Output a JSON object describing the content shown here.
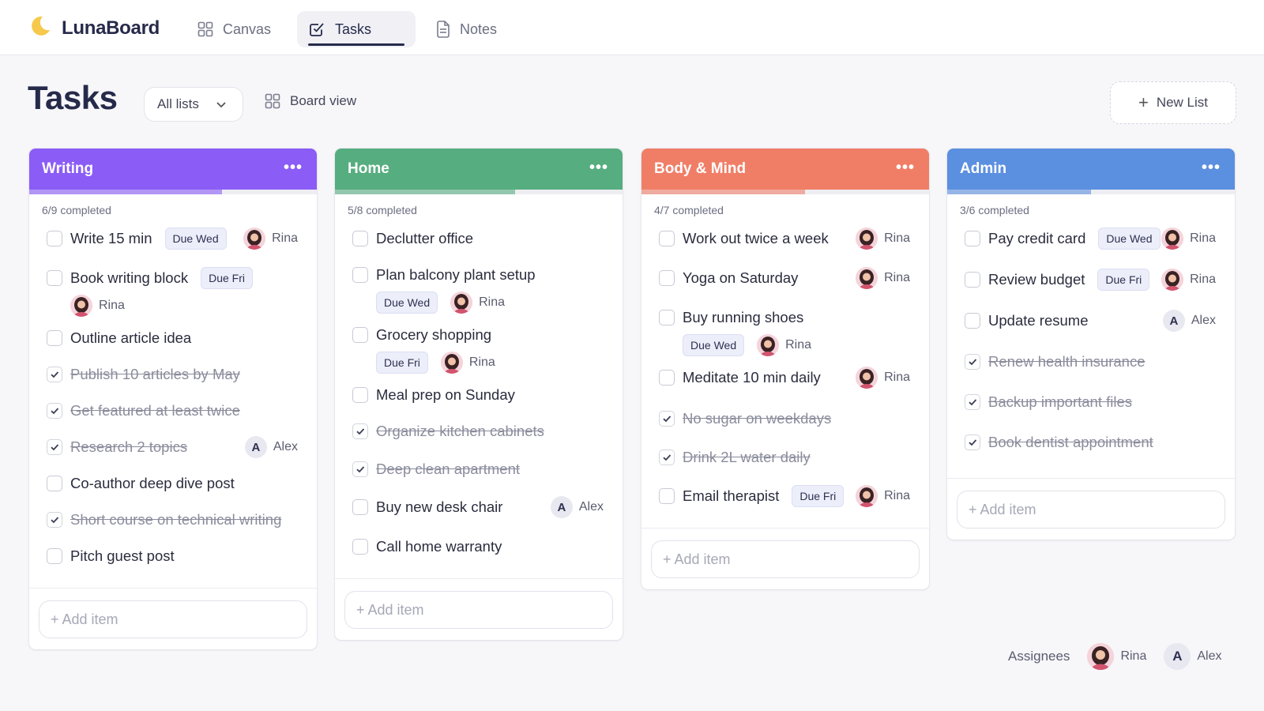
{
  "app": {
    "name": "LunaBoard"
  },
  "nav": {
    "tabs": [
      {
        "label": "Canvas",
        "icon": "grid-icon",
        "active": false
      },
      {
        "label": "Tasks",
        "icon": "checkbox-icon",
        "active": true
      },
      {
        "label": "Notes",
        "icon": "document-icon",
        "active": false
      }
    ]
  },
  "header": {
    "title": "Tasks",
    "filter": "All lists",
    "view": "Board view",
    "new_list": "New List"
  },
  "lists": [
    {
      "name": "Writing",
      "color": "#8b5cf6",
      "progress": 0.67,
      "completed": "6/9 completed",
      "items": [
        {
          "text": "Write 15 min",
          "due": "Due Wed",
          "assignee": "Rina",
          "done": false
        },
        {
          "text": "Book writing block",
          "due": "Due Fri",
          "assignee": "Rina",
          "done": false
        },
        {
          "text": "Outline article idea",
          "done": false
        },
        {
          "text": "Publish 10 articles by May",
          "done": true
        },
        {
          "text": "Get featured at least twice",
          "done": true
        },
        {
          "text": "Research 2 topics",
          "assignee": "Alex",
          "done": true
        },
        {
          "text": "Co-author deep dive post",
          "done": false
        },
        {
          "text": "Short course on technical writing",
          "done": true
        },
        {
          "text": "Pitch guest post",
          "done": false
        }
      ],
      "add_item": "+ Add item"
    },
    {
      "name": "Home",
      "color": "#56ad7f",
      "progress": 0.625,
      "completed": "5/8 completed",
      "items": [
        {
          "text": "Declutter office",
          "done": false
        },
        {
          "text": "Plan balcony plant setup",
          "due": "Due Wed",
          "assignee": "Rina",
          "done": false
        },
        {
          "text": "Grocery shopping",
          "due": "Due Fri",
          "assignee": "Rina",
          "done": false
        },
        {
          "text": "Meal prep on Sunday",
          "done": false
        },
        {
          "text": "Organize kitchen cabinets",
          "done": true
        },
        {
          "text": "Deep clean apartment",
          "done": true
        },
        {
          "text": "Buy new desk chair",
          "assignee": "Alex",
          "done": false
        },
        {
          "text": "Call home warranty",
          "done": false
        }
      ],
      "add_item": "+ Add item"
    },
    {
      "name": "Body & Mind",
      "color": "#f07e67",
      "progress": 0.57,
      "completed": "4/7 completed",
      "items": [
        {
          "text": "Work out twice a week",
          "assignee": "Rina",
          "done": false
        },
        {
          "text": "Yoga on Saturday",
          "assignee": "Rina",
          "done": false
        },
        {
          "text": "Buy running shoes",
          "due": "Due Wed",
          "assignee": "Rina",
          "done": false
        },
        {
          "text": "Meditate 10 min daily",
          "assignee": "Rina",
          "done": false
        },
        {
          "text": "No sugar on weekdays",
          "done": true
        },
        {
          "text": "Drink 2L water daily",
          "done": true
        },
        {
          "text": "Email therapist",
          "due": "Due Fri",
          "assignee": "Rina",
          "done": false
        }
      ],
      "add_item": "+ Add item"
    },
    {
      "name": "Admin",
      "color": "#5b8fe0",
      "progress": 0.5,
      "completed": "3/6 completed",
      "items": [
        {
          "text": "Pay credit card",
          "due": "Due Wed",
          "assignee": "Rina",
          "done": false
        },
        {
          "text": "Review budget",
          "due": "Due Fri",
          "assignee": "Rina",
          "done": false
        },
        {
          "text": "Update resume",
          "assignee": "Alex",
          "done": false
        },
        {
          "text": "Renew health insurance",
          "done": true
        },
        {
          "text": "Backup important files",
          "done": true
        },
        {
          "text": "Book dentist appointment",
          "done": true
        }
      ],
      "add_item": "+ Add item"
    }
  ],
  "footer": {
    "label": "Assignees",
    "people": [
      {
        "name": "Rina",
        "avatar": "photo"
      },
      {
        "name": "Alex",
        "avatar": "A"
      }
    ]
  }
}
